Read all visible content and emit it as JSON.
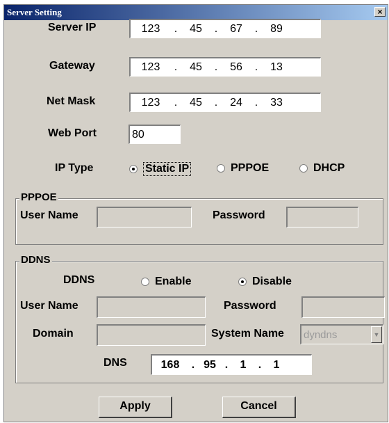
{
  "window": {
    "title": "Server Setting",
    "close_glyph": "×"
  },
  "server": {
    "server_ip": {
      "label": "Server IP",
      "octets": [
        "123",
        "45",
        "67",
        "89"
      ]
    },
    "gateway": {
      "label": "Gateway",
      "octets": [
        "123",
        "45",
        "56",
        "13"
      ]
    },
    "net_mask": {
      "label": "Net Mask",
      "octets": [
        "123",
        "45",
        "24",
        "33"
      ]
    },
    "web_port": {
      "label": "Web Port",
      "value": "80"
    },
    "ip_type": {
      "label": "IP Type",
      "options": [
        {
          "label": "Static IP",
          "selected": true
        },
        {
          "label": "PPPOE",
          "selected": false
        },
        {
          "label": "DHCP",
          "selected": false
        }
      ]
    }
  },
  "pppoe": {
    "group_label": "PPPOE",
    "user_name_label": "User Name",
    "user_name_value": "",
    "password_label": "Password",
    "password_value": ""
  },
  "ddns": {
    "group_label": "DDNS",
    "ddns_label": "DDNS",
    "options": [
      {
        "label": "Enable",
        "selected": false
      },
      {
        "label": "Disable",
        "selected": true
      }
    ],
    "user_name_label": "User Name",
    "password_label": "Password",
    "domain_label": "Domain",
    "system_name_label": "System Name",
    "system_name_value": "dyndns",
    "dns_label": "DNS",
    "dns_octets": [
      "168",
      "95",
      "1",
      "1"
    ]
  },
  "buttons": {
    "apply": "Apply",
    "cancel": "Cancel"
  },
  "icons": {
    "close": "close-icon",
    "dropdown": "chevron-down-icon",
    "radio": "radio-button-icon"
  }
}
